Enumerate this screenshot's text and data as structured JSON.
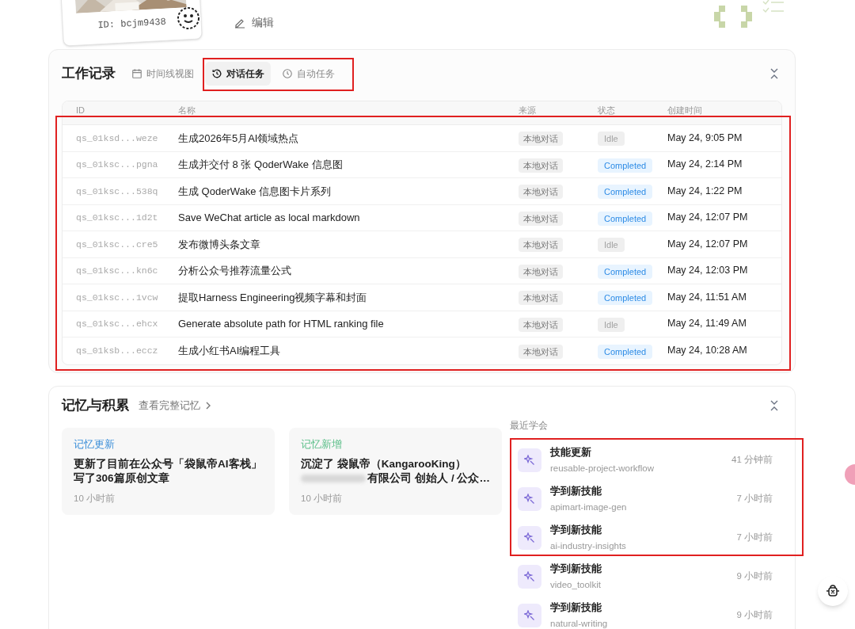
{
  "profile": {
    "id_label": "ID: bcjm9438",
    "edit": "编辑"
  },
  "work": {
    "title": "工作记录",
    "tabs": [
      {
        "label": "时间线视图",
        "selected": false
      },
      {
        "label": "对话任务",
        "selected": true
      },
      {
        "label": "自动任务",
        "selected": false
      }
    ],
    "columns": [
      "ID",
      "名称",
      "来源",
      "状态",
      "创建时间"
    ],
    "rows": [
      {
        "id": "qs_01ksd...weze",
        "name": "生成2026年5月AI领域热点",
        "source": "本地对话",
        "status": {
          "text": "Idle",
          "kind": "idle"
        },
        "created": "May 24, 9:05 PM"
      },
      {
        "id": "qs_01ksc...pgna",
        "name": "生成并交付 8 张 QoderWake 信息图",
        "source": "本地对话",
        "status": {
          "text": "Completed",
          "kind": "completed"
        },
        "created": "May 24, 2:14 PM"
      },
      {
        "id": "qs_01ksc...538q",
        "name": "生成 QoderWake 信息图卡片系列",
        "source": "本地对话",
        "status": {
          "text": "Completed",
          "kind": "completed"
        },
        "created": "May 24, 1:22 PM"
      },
      {
        "id": "qs_01ksc...1d2t",
        "name": "Save WeChat article as local markdown",
        "source": "本地对话",
        "status": {
          "text": "Completed",
          "kind": "completed"
        },
        "created": "May 24, 12:07 PM"
      },
      {
        "id": "qs_01ksc...cre5",
        "name": "发布微博头条文章",
        "source": "本地对话",
        "status": {
          "text": "Idle",
          "kind": "idle"
        },
        "created": "May 24, 12:07 PM"
      },
      {
        "id": "qs_01ksc...kn6c",
        "name": "分析公众号推荐流量公式",
        "source": "本地对话",
        "status": {
          "text": "Completed",
          "kind": "completed"
        },
        "created": "May 24, 12:03 PM"
      },
      {
        "id": "qs_01ksc...1vcw",
        "name": "提取Harness Engineering视频字幕和封面",
        "source": "本地对话",
        "status": {
          "text": "Completed",
          "kind": "completed"
        },
        "created": "May 24, 11:51 AM"
      },
      {
        "id": "qs_01ksc...ehcx",
        "name": "Generate absolute path for HTML ranking file",
        "source": "本地对话",
        "status": {
          "text": "Idle",
          "kind": "idle"
        },
        "created": "May 24, 11:49 AM"
      },
      {
        "id": "qs_01ksb...eccz",
        "name": "生成小红书AI编程工具",
        "source": "本地对话",
        "status": {
          "text": "Completed",
          "kind": "completed"
        },
        "created": "May 24, 10:28 AM"
      }
    ]
  },
  "memory": {
    "title": "记忆与积累",
    "link": "查看完整记忆",
    "cards": [
      {
        "tag": "记忆更新",
        "color": "#3b8fd9",
        "lines": [
          "更新了目前在公众号「袋鼠帝AI客栈」",
          "写了306篇原创文章"
        ],
        "blurred": false,
        "time": "10 小时前"
      },
      {
        "tag": "记忆新增",
        "color": "#5cbf8a",
        "lines": [
          "沉淀了 袋鼠帝（KangarooKing）",
          "有限公司 创始人 / 公众…"
        ],
        "blurred": true,
        "time": "10 小时前"
      }
    ],
    "recent_label": "最近学会",
    "skills": [
      {
        "title": "技能更新",
        "name": "reusable-project-workflow",
        "time": "41 分钟前"
      },
      {
        "title": "学到新技能",
        "name": "apimart-image-gen",
        "time": "7 小时前"
      },
      {
        "title": "学到新技能",
        "name": "ai-industry-insights",
        "time": "7 小时前"
      },
      {
        "title": "学到新技能",
        "name": "video_toolkit",
        "time": "9 小时前"
      },
      {
        "title": "学到新技能",
        "name": "natural-writing",
        "time": "9 小时前"
      }
    ]
  }
}
